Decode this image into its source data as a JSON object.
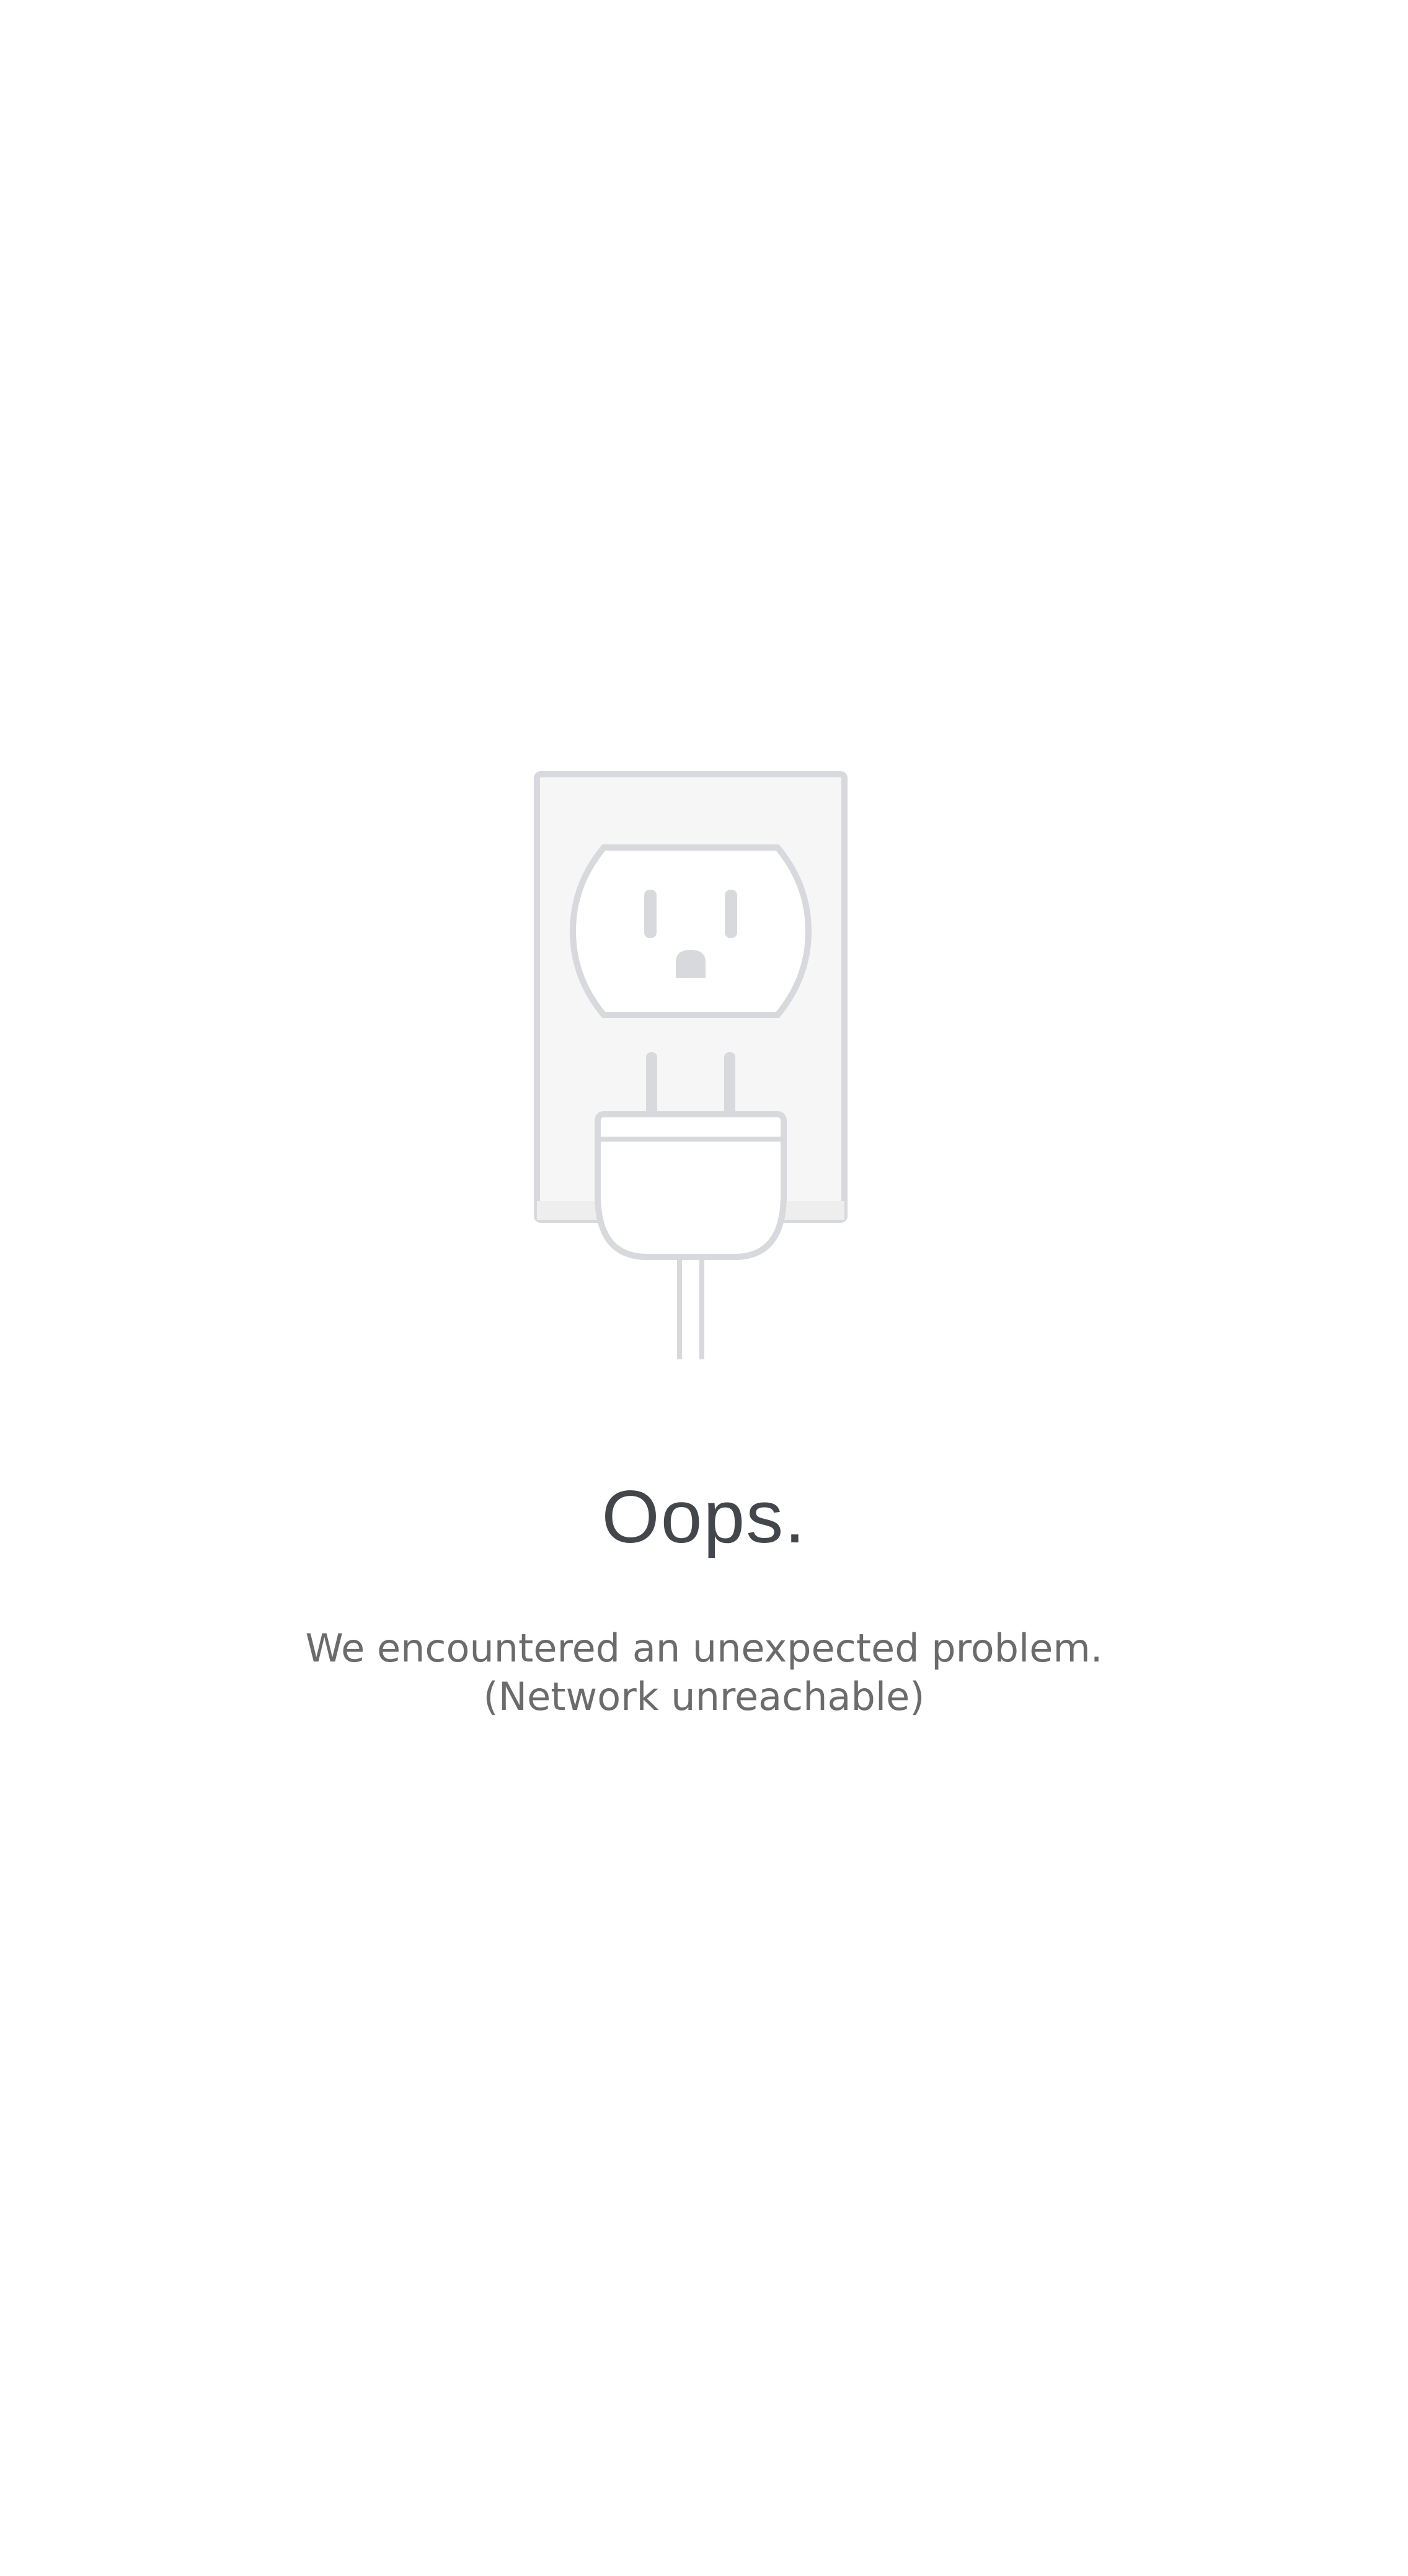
{
  "error": {
    "illustration_icon": "unplugged-outlet-icon",
    "title": "Oops.",
    "message_line1": "We encountered an unexpected problem.",
    "message_line2": "(Network unreachable)"
  },
  "colors": {
    "background": "#ffffff",
    "title": "#43474b",
    "message": "#6b6b6b",
    "illustration_stroke": "#d7d9dc",
    "illustration_fill": "#f6f6f6"
  }
}
